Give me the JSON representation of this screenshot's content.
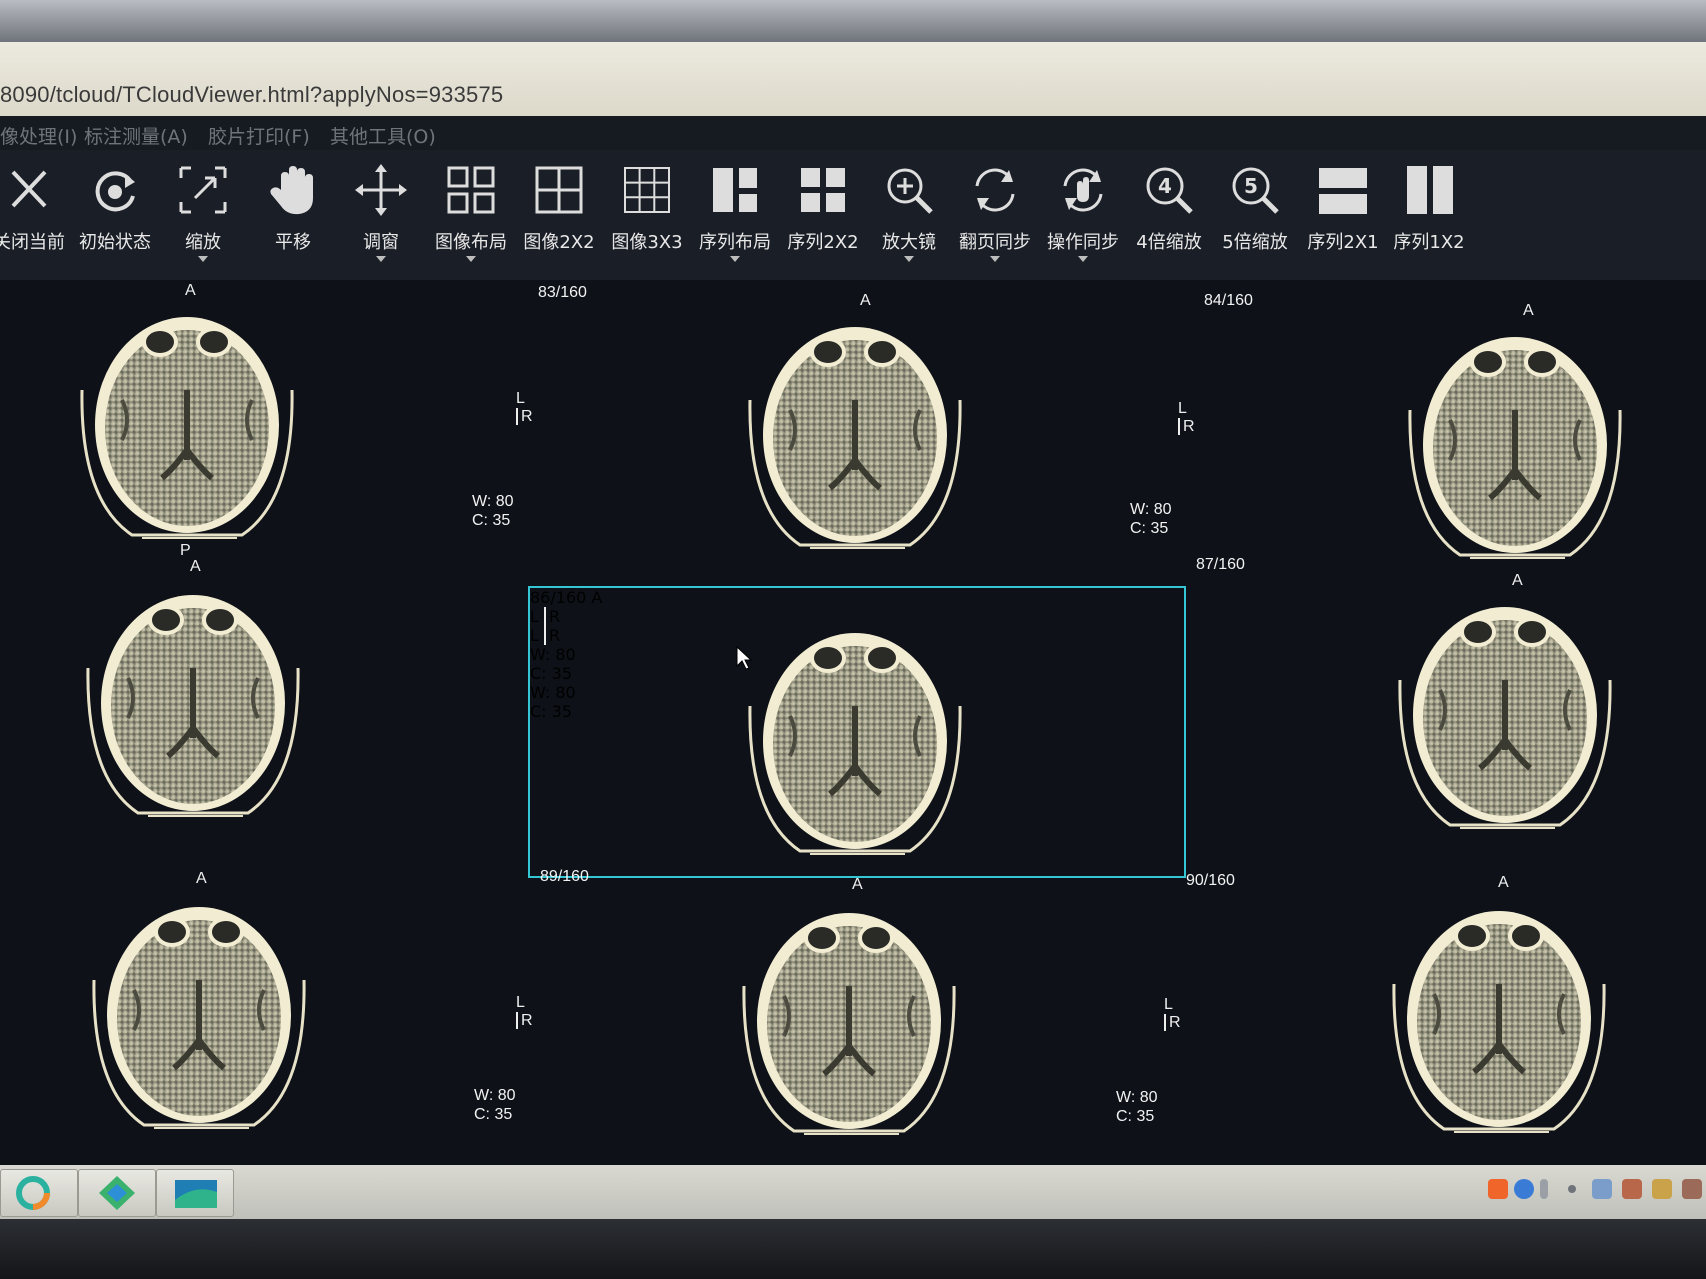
{
  "address": {
    "url": "8090/tcloud/TCloudViewer.html?applyNos=933575"
  },
  "menu": [
    {
      "label": "像处理(I)"
    },
    {
      "label": "标注测量(A)"
    },
    {
      "label": "胶片打印(F)"
    },
    {
      "label": "其他工具(O)"
    }
  ],
  "toolbar": [
    {
      "label": "关闭当前",
      "icon": "close-icon"
    },
    {
      "label": "初始状态",
      "icon": "reset-icon"
    },
    {
      "label": "缩放",
      "icon": "zoom-icon"
    },
    {
      "label": "平移",
      "icon": "hand-icon"
    },
    {
      "label": "调窗",
      "icon": "move-icon"
    },
    {
      "label": "图像布局",
      "icon": "image-layout-icon"
    },
    {
      "label": "图像2X2",
      "icon": "grid-2x2-icon"
    },
    {
      "label": "图像3X3",
      "icon": "grid-3x3-icon"
    },
    {
      "label": "序列布局",
      "icon": "series-layout-icon"
    },
    {
      "label": "序列2X2",
      "icon": "series-2x2-icon"
    },
    {
      "label": "放大镜",
      "icon": "magnifier-icon"
    },
    {
      "label": "翻页同步",
      "icon": "page-sync-icon"
    },
    {
      "label": "操作同步",
      "icon": "operation-sync-icon"
    },
    {
      "label": "4倍缩放",
      "icon": "zoom-4x-icon"
    },
    {
      "label": "5倍缩放",
      "icon": "zoom-5x-icon"
    },
    {
      "label": "序列2X1",
      "icon": "series-2x1-icon"
    },
    {
      "label": "序列1X2",
      "icon": "series-1x2-icon"
    }
  ],
  "orientation": {
    "anterior": "A",
    "posterior": "P",
    "left": "L",
    "right": "R"
  },
  "window": {
    "width": "W: 80",
    "center": "C: 35"
  },
  "images": [
    {
      "index": "",
      "w": "",
      "c": ""
    },
    {
      "index": "83/160",
      "w": "W: 80",
      "c": "C: 35"
    },
    {
      "index": "84/160",
      "w": "W: 80",
      "c": "C: 35"
    },
    {
      "index": "",
      "w": "",
      "c": ""
    },
    {
      "index": "86/160",
      "w": "W: 80",
      "c": "C: 35"
    },
    {
      "index": "87/160",
      "w": "",
      "c": ""
    },
    {
      "index": "",
      "w": "",
      "c": ""
    },
    {
      "index": "89/160",
      "w": "W: 80",
      "c": "C: 35"
    },
    {
      "index": "90/160",
      "w": "W: 80",
      "c": "C: 35"
    }
  ]
}
